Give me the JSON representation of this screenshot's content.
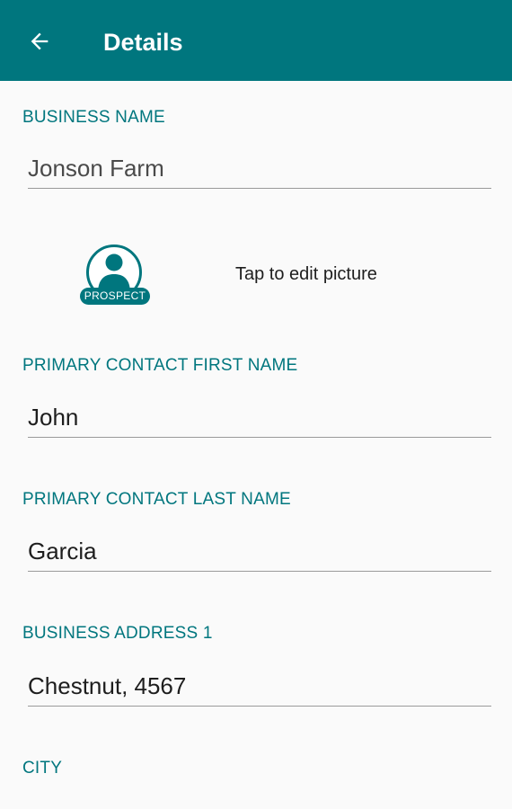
{
  "appbar": {
    "title": "Details",
    "back_icon": "arrow-left-icon",
    "color": "#00767e"
  },
  "form": {
    "business_name": {
      "label": "BUSINESS NAME",
      "value": "Jonson Farm"
    },
    "picture": {
      "badge": "PROSPECT",
      "avatar_icon": "person-avatar-icon",
      "hint": "Tap to edit picture"
    },
    "first_name": {
      "label": "PRIMARY CONTACT FIRST NAME",
      "value": "John"
    },
    "last_name": {
      "label": "PRIMARY CONTACT LAST NAME",
      "value": "Garcia"
    },
    "address1": {
      "label": "BUSINESS ADDRESS 1",
      "value": "Chestnut, 4567"
    },
    "city": {
      "label": "CITY"
    }
  },
  "colors": {
    "accent": "#00767e",
    "background": "#fafafa",
    "text": "#1e1e1e"
  }
}
